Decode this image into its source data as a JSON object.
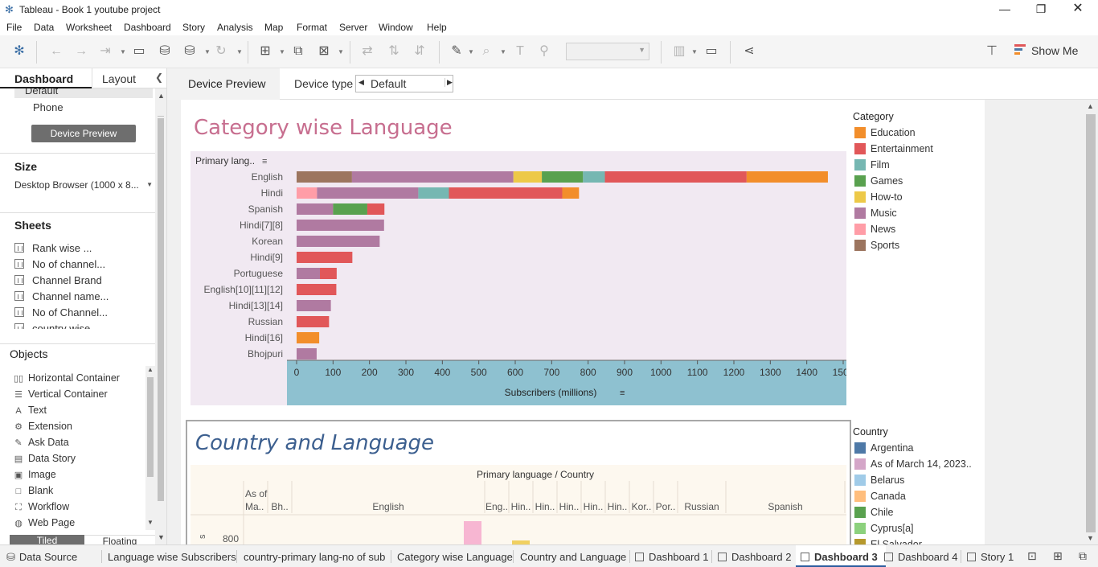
{
  "window": {
    "title": "Tableau - Book 1 youtube project"
  },
  "menu": [
    "File",
    "Data",
    "Worksheet",
    "Dashboard",
    "Story",
    "Analysis",
    "Map",
    "Format",
    "Server",
    "Window",
    "Help"
  ],
  "toolbar": {
    "show_me_label": "Show Me"
  },
  "left_panel": {
    "tabs": [
      "Dashboard",
      "Layout"
    ],
    "device_list": [
      "Default",
      "Phone"
    ],
    "device_preview_button": "Device Preview",
    "size_title": "Size",
    "size_value": "Desktop Browser (1000 x 8...",
    "sheets_title": "Sheets",
    "sheets": [
      "Rank wise ...",
      "No of channel...",
      "Channel Brand",
      "Channel name...",
      "No of Channel...",
      "country wise..."
    ],
    "objects_title": "Objects",
    "objects": [
      {
        "label": "Horizontal Container",
        "icon": "horizontal-container-icon",
        "glyph": "▯▯"
      },
      {
        "label": "Vertical Container",
        "icon": "vertical-container-icon",
        "glyph": "☰"
      },
      {
        "label": "Text",
        "icon": "text-icon",
        "glyph": "A"
      },
      {
        "label": "Extension",
        "icon": "extension-icon",
        "glyph": "⚙"
      },
      {
        "label": "Ask Data",
        "icon": "ask-data-icon",
        "glyph": "✎"
      },
      {
        "label": "Data Story",
        "icon": "data-story-icon",
        "glyph": "▤"
      },
      {
        "label": "Image",
        "icon": "image-icon",
        "glyph": "▣"
      },
      {
        "label": "Blank",
        "icon": "blank-icon",
        "glyph": "□"
      },
      {
        "label": "Workflow",
        "icon": "workflow-icon",
        "glyph": "⛶"
      },
      {
        "label": "Web Page",
        "icon": "web-page-icon",
        "glyph": "◍"
      }
    ],
    "layout_mode": [
      "Tiled",
      "Floating"
    ]
  },
  "device_bar": {
    "preview_label": "Device Preview",
    "device_type_label": "Device type",
    "device_type_value": "Default"
  },
  "chart_data": [
    {
      "type": "bar",
      "orientation": "horizontal",
      "stacked": true,
      "title": "Category wise Language",
      "row_header": "Primary lang..",
      "xlabel": "Subscribers (millions)",
      "xlim": [
        0,
        1500
      ],
      "xticks": [
        0,
        100,
        200,
        300,
        400,
        500,
        600,
        700,
        800,
        900,
        1000,
        1100,
        1200,
        1300,
        1400,
        1500
      ],
      "legend_title": "Category",
      "legend_position": "right",
      "categories_legend": [
        {
          "name": "Education",
          "color": "#f28e2b"
        },
        {
          "name": "Entertainment",
          "color": "#e15759"
        },
        {
          "name": "Film",
          "color": "#76b7b2"
        },
        {
          "name": "Games",
          "color": "#59a14f"
        },
        {
          "name": "How-to",
          "color": "#edc948"
        },
        {
          "name": "Music",
          "color": "#b07aa1"
        },
        {
          "name": "News",
          "color": "#ff9da7"
        },
        {
          "name": "Sports",
          "color": "#9c755f"
        }
      ],
      "rows": [
        {
          "label": "English",
          "segments": [
            [
              "Sports",
              152
            ],
            [
              "Music",
              443
            ],
            [
              "How-to",
              78
            ],
            [
              "Games",
              113
            ],
            [
              "Film",
              60
            ],
            [
              "Entertainment",
              389
            ],
            [
              "Education",
              223
            ]
          ]
        },
        {
          "label": "Hindi",
          "segments": [
            [
              "News",
              56
            ],
            [
              "Music",
              278
            ],
            [
              "Film",
              84
            ],
            [
              "Entertainment",
              311
            ],
            [
              "Education",
              46
            ]
          ]
        },
        {
          "label": "Spanish",
          "segments": [
            [
              "Music",
              100
            ],
            [
              "Games",
              94
            ],
            [
              "Entertainment",
              47
            ]
          ]
        },
        {
          "label": "Hindi[7][8]",
          "segments": [
            [
              "Music",
              240
            ]
          ]
        },
        {
          "label": "Korean",
          "segments": [
            [
              "Music",
              228
            ]
          ]
        },
        {
          "label": "Hindi[9]",
          "segments": [
            [
              "Entertainment",
              153
            ]
          ]
        },
        {
          "label": "Portuguese",
          "segments": [
            [
              "Music",
              64
            ],
            [
              "Entertainment",
              46
            ]
          ]
        },
        {
          "label": "English[10][11][12]",
          "segments": [
            [
              "Entertainment",
              109
            ]
          ]
        },
        {
          "label": "Hindi[13][14]",
          "segments": [
            [
              "Music",
              94
            ]
          ]
        },
        {
          "label": "Russian",
          "segments": [
            [
              "Entertainment",
              89
            ]
          ]
        },
        {
          "label": "Hindi[16]",
          "segments": [
            [
              "Education",
              62
            ]
          ]
        },
        {
          "label": "Bhojpuri",
          "segments": [
            [
              "Music",
              55
            ]
          ]
        }
      ]
    },
    {
      "type": "bar",
      "title": "Country and Language",
      "header": "Primary language / Country",
      "column_groups": [
        "As of Ma..",
        "Bh..",
        "English",
        "Eng..",
        "Hin..",
        "Hin..",
        "Hin..",
        "Hin..",
        "Hin..",
        "Kor..",
        "Por..",
        "Russian",
        "Spanish"
      ],
      "yticks_visible": [
        800
      ],
      "legend_title": "Country",
      "legend_position": "right",
      "countries_legend": [
        {
          "name": "Argentina",
          "color": "#4e79a7"
        },
        {
          "name": "As of March 14, 2023..",
          "color": "#d4a6c8"
        },
        {
          "name": "Belarus",
          "color": "#a0cbe8"
        },
        {
          "name": "Canada",
          "color": "#ffbe7d"
        },
        {
          "name": "Chile",
          "color": "#59a14f"
        },
        {
          "name": "Cyprus[a]",
          "color": "#8cd17d"
        },
        {
          "name": "El Salvador",
          "color": "#b6992d"
        }
      ]
    }
  ],
  "sheet_tabs": [
    {
      "label": "Data Source",
      "kind": "datasource"
    },
    {
      "label": "Language wise Subscribers",
      "kind": "sheet"
    },
    {
      "label": "country-primary lang-no of sub",
      "kind": "sheet"
    },
    {
      "label": "Category wise Language",
      "kind": "sheet"
    },
    {
      "label": "Country and Language",
      "kind": "sheet"
    },
    {
      "label": "Dashboard 1",
      "kind": "dashboard"
    },
    {
      "label": "Dashboard 2",
      "kind": "dashboard"
    },
    {
      "label": "Dashboard 3",
      "kind": "dashboard",
      "active": true
    },
    {
      "label": "Dashboard 4",
      "kind": "dashboard"
    },
    {
      "label": "Story 1",
      "kind": "story"
    }
  ]
}
